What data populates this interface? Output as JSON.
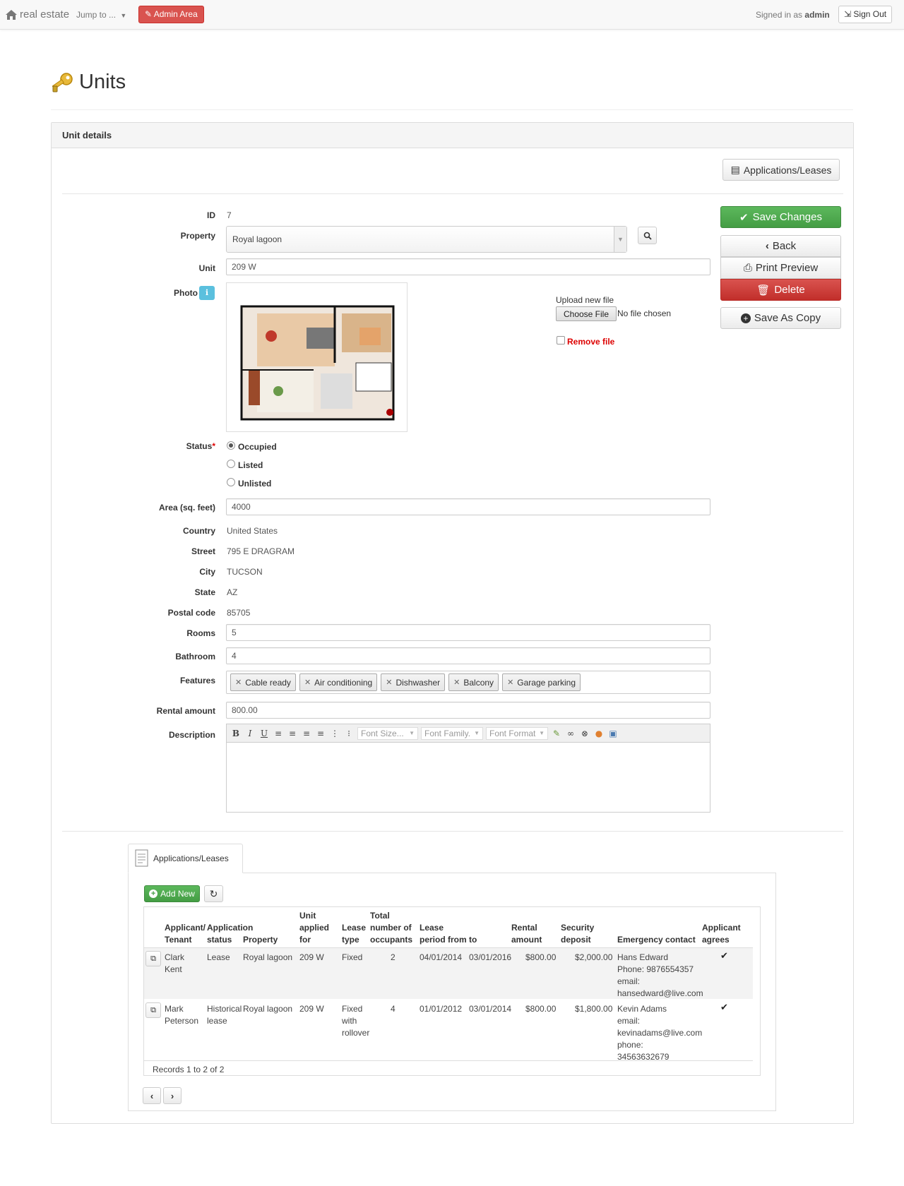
{
  "navbar": {
    "brand": "real estate",
    "jump": "Jump to ...",
    "admin": "Admin Area",
    "signed_prefix": "Signed in as",
    "user": "admin",
    "signout": "Sign Out"
  },
  "page": {
    "title": "Units"
  },
  "panel": {
    "title": "Unit details",
    "apps_button": "Applications/Leases",
    "actions": {
      "save": "Save Changes",
      "back": "Back",
      "print": "Print Preview",
      "delete": "Delete",
      "copy": "Save As Copy"
    }
  },
  "form": {
    "id": {
      "label": "ID",
      "value": "7"
    },
    "property": {
      "label": "Property",
      "value": "Royal lagoon"
    },
    "unit": {
      "label": "Unit",
      "value": "209 W"
    },
    "photo": {
      "label": "Photo",
      "upload_label": "Upload new file",
      "choose": "Choose File",
      "no_file": "No file chosen",
      "remove": "Remove file"
    },
    "status": {
      "label": "Status",
      "required": "*",
      "options": [
        "Occupied",
        "Listed",
        "Unlisted"
      ],
      "selected": "Occupied"
    },
    "area": {
      "label": "Area (sq. feet)",
      "value": "4000"
    },
    "country": {
      "label": "Country",
      "value": "United States"
    },
    "street": {
      "label": "Street",
      "value": "795 E DRAGRAM"
    },
    "city": {
      "label": "City",
      "value": "TUCSON"
    },
    "state": {
      "label": "State",
      "value": "AZ"
    },
    "postal": {
      "label": "Postal code",
      "value": "85705"
    },
    "rooms": {
      "label": "Rooms",
      "value": "5"
    },
    "bathroom": {
      "label": "Bathroom",
      "value": "4"
    },
    "features": {
      "label": "Features",
      "tags": [
        "Cable ready",
        "Air conditioning",
        "Dishwasher",
        "Balcony",
        "Garage parking"
      ]
    },
    "rental": {
      "label": "Rental amount",
      "value": "800.00"
    },
    "description": {
      "label": "Description",
      "font_size": "Font Size...",
      "font_family": "Font Family.",
      "font_format": "Font Format"
    }
  },
  "leases": {
    "tab": "Applications/Leases",
    "add_new": "Add New",
    "columns": [
      [
        "Applicant/",
        "Tenant"
      ],
      [
        "Application",
        "status"
      ],
      [
        "Property"
      ],
      [
        "Unit",
        "applied",
        "for"
      ],
      [
        "Lease",
        "type"
      ],
      [
        "Total",
        "number of",
        "occupants"
      ],
      [
        "Lease",
        "period from"
      ],
      [
        "to"
      ],
      [
        "Rental",
        "amount"
      ],
      [
        "Security",
        "deposit"
      ],
      [
        "Emergency contact"
      ],
      [
        "Applicant",
        "agrees"
      ]
    ],
    "rows": [
      {
        "tenant": [
          "Clark",
          "Kent"
        ],
        "status": [
          "Lease"
        ],
        "property": "Royal lagoon",
        "unit": "209 W",
        "type": [
          "Fixed"
        ],
        "occupants": "2",
        "from": "04/01/2014",
        "to": "03/01/2016",
        "rental": "$800.00",
        "deposit": "$2,000.00",
        "contact": [
          "Hans Edward",
          "Phone: 9876554357",
          "email:",
          "hansedward@live.com"
        ]
      },
      {
        "tenant": [
          "Mark",
          "Peterson"
        ],
        "status": [
          "Historical",
          "lease"
        ],
        "property": "Royal lagoon",
        "unit": "209 W",
        "type": [
          "Fixed",
          "with",
          "rollover"
        ],
        "occupants": "4",
        "from": "01/01/2012",
        "to": "03/01/2014",
        "rental": "$800.00",
        "deposit": "$1,800.00",
        "contact": [
          "Kevin Adams",
          "email:",
          "kevinadams@live.com",
          "phone:",
          "34563632679"
        ]
      }
    ],
    "records": "Records 1 to 2 of 2"
  }
}
